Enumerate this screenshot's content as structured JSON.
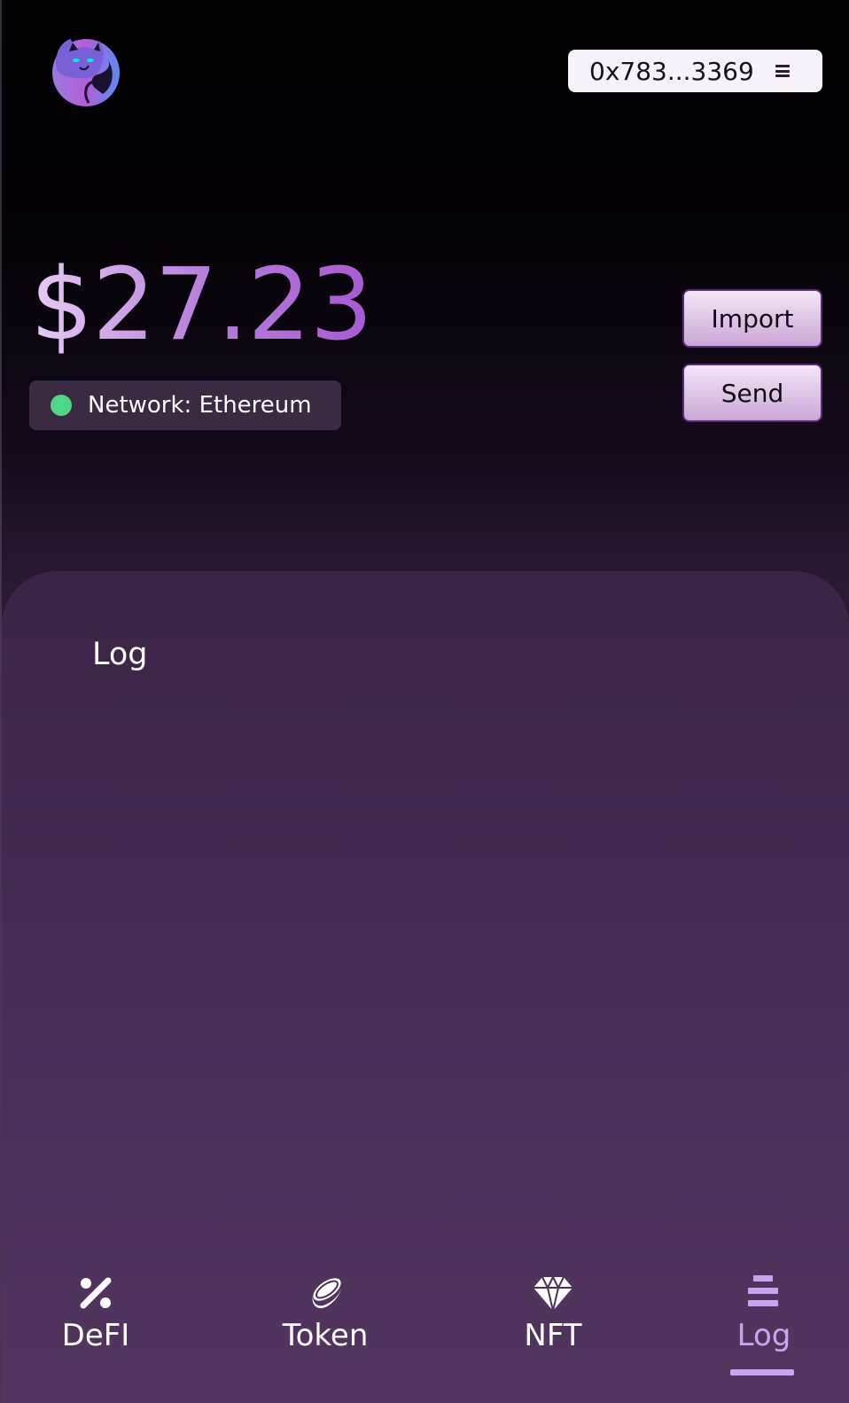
{
  "header": {
    "logo_icon": "cat-logo-icon",
    "address": "0x783...3369",
    "menu_icon": "hamburger-icon"
  },
  "wallet": {
    "balance": "$27.23",
    "network_label": "Network: Ethereum",
    "network_status_color": "#4ed685"
  },
  "actions": {
    "import_label": "Import",
    "send_label": "Send"
  },
  "panel": {
    "title": "Log"
  },
  "tabs": [
    {
      "label": "DeFI",
      "icon": "percent-icon",
      "active": false
    },
    {
      "label": "Token",
      "icon": "coin-icon",
      "active": false
    },
    {
      "label": "NFT",
      "icon": "diamond-icon",
      "active": false
    },
    {
      "label": "Log",
      "icon": "list-icon",
      "active": true
    }
  ],
  "colors": {
    "accent": "#c8a4ef",
    "balance_gradient_start": "#e6cdf3",
    "balance_gradient_end": "#a65bd1"
  }
}
